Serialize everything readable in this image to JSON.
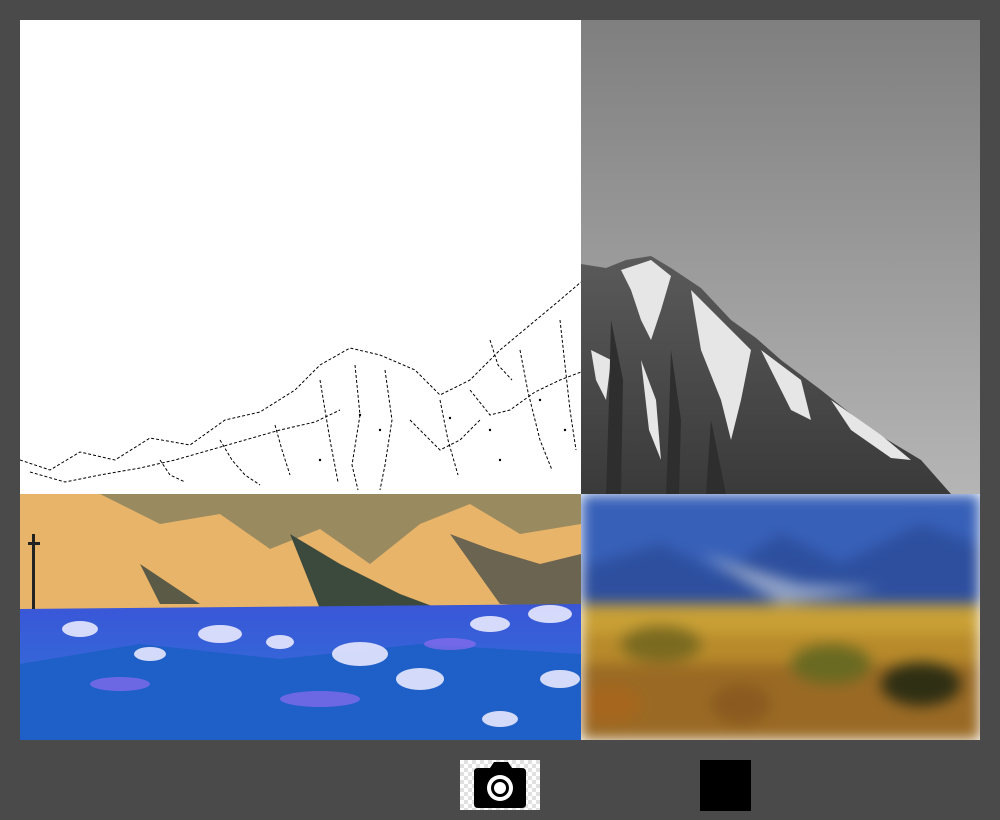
{
  "app": {
    "background": "#4a4a4a"
  },
  "viewport": {
    "panels": [
      {
        "name": "edge-detection",
        "description_icon": "mountain-edges-image"
      },
      {
        "name": "grayscale",
        "description_icon": "mountain-grayscale-image"
      },
      {
        "name": "color-inverted",
        "description_icon": "mountain-negative-image"
      },
      {
        "name": "blurred",
        "description_icon": "mountain-blur-image"
      }
    ]
  },
  "toolbar": {
    "capture_icon": "camera-icon",
    "stop_icon": "stop-square-icon",
    "capture_bg": "#ffffff",
    "stop_bg": "#000000"
  }
}
